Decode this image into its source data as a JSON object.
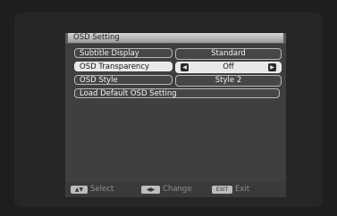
{
  "menu": {
    "title": "OSD Setting",
    "rows": [
      {
        "label": "Subtitle Display",
        "value": "Standard"
      },
      {
        "label": "OSD Transparency",
        "value": "Off"
      },
      {
        "label": "OSD Style",
        "value": "Style 2"
      },
      {
        "label": "Load Default OSD Setting"
      }
    ]
  },
  "footer": {
    "select_key": "▲▼",
    "select_label": "Select",
    "change_key": "◀▶",
    "change_label": "Change",
    "exit_key": "EXIT",
    "exit_label": "Exit"
  }
}
